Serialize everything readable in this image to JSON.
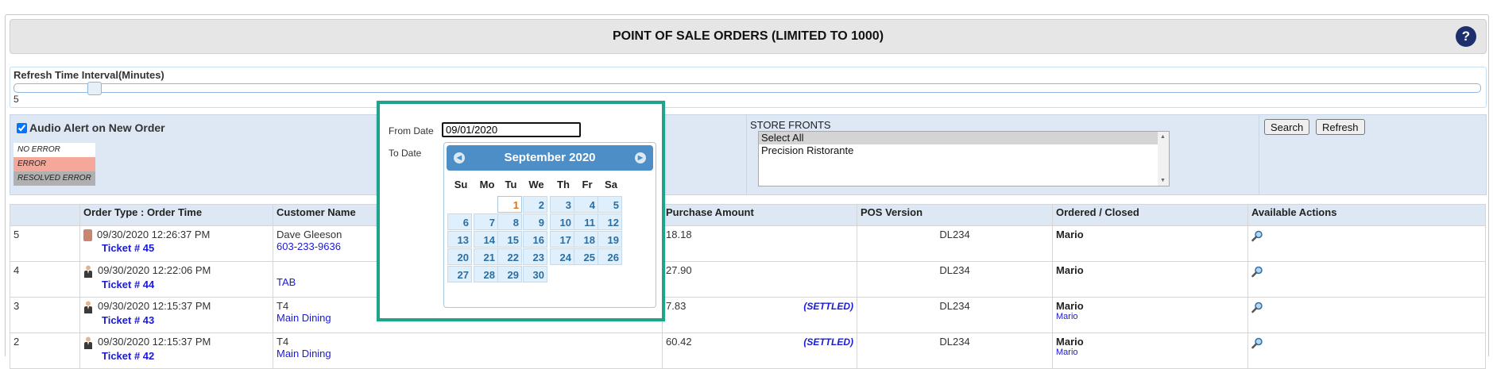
{
  "header": {
    "title": "POINT OF SALE ORDERS (LIMITED TO 1000)",
    "help_label": "?"
  },
  "refresh": {
    "label": "Refresh Time Interval(Minutes)",
    "value": "5",
    "slider_fraction": 0.05
  },
  "filters": {
    "audio_alert_label": "Audio Alert on New Order",
    "audio_alert_checked": true,
    "legend": {
      "no_error": "NO ERROR",
      "error": "ERROR",
      "resolved_error": "RESOLVED ERROR"
    },
    "from_date_label": "From Date",
    "from_date_value": "09/01/2020",
    "to_date_label": "To Date",
    "store_fronts_label": "STORE FRONTS",
    "store_options": [
      "Select All",
      "Precision Ristorante"
    ],
    "search_label": "Search",
    "refresh_label": "Refresh"
  },
  "calendar": {
    "month_title": "September 2020",
    "days_of_week": [
      "Su",
      "Mo",
      "Tu",
      "We",
      "Th",
      "Fr",
      "Sa"
    ],
    "first_day_column": 2,
    "num_days": 30,
    "today": "1"
  },
  "table": {
    "headers": [
      "",
      "Order Type : Order Time",
      "Customer Name",
      "",
      "Purchase Amount",
      "POS Version",
      "Ordered / Closed",
      "Available Actions"
    ],
    "rows": [
      {
        "num": "5",
        "time": "09/30/2020 12:26:37 PM",
        "ticket": "Ticket # 45",
        "customer": "Dave Gleeson",
        "customer_sub": "603-233-9636",
        "amount": "18.18",
        "status": "",
        "pos": "DL234",
        "ordered": "Mario",
        "closed": ""
      },
      {
        "num": "4",
        "time": "09/30/2020 12:22:06 PM",
        "ticket": "Ticket # 44",
        "customer": "",
        "customer_sub": "TAB",
        "amount": "27.90",
        "status": "",
        "pos": "DL234",
        "ordered": "Mario",
        "closed": ""
      },
      {
        "num": "3",
        "time": "09/30/2020 12:15:37 PM",
        "ticket": "Ticket # 43",
        "customer": "T4",
        "customer_sub": "Main Dining",
        "amount": "7.83",
        "status": "(SETTLED)",
        "pos": "DL234",
        "ordered": "Mario",
        "closed": "Mario"
      },
      {
        "num": "2",
        "time": "09/30/2020 12:15:37 PM",
        "ticket": "Ticket # 42",
        "customer": "T4",
        "customer_sub": "Main Dining",
        "amount": "60.42",
        "status": "(SETTLED)",
        "pos": "DL234",
        "ordered": "Mario",
        "closed": "Mario"
      }
    ]
  }
}
